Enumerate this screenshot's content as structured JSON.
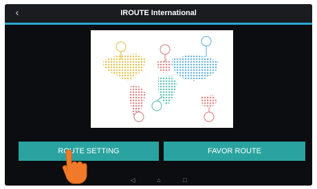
{
  "header": {
    "title": "IROUTE International",
    "back_icon": "chevron-left-icon"
  },
  "map": {
    "icon": "world-map-icon",
    "region_colors": [
      "#e3c65a",
      "#d98c8c",
      "#6fb7dc",
      "#67c3b8",
      "#e08a86"
    ]
  },
  "buttons": {
    "route_setting": "ROUTE SETTING",
    "favor_route": "FAVOR ROUTE"
  },
  "navbar": {
    "back_icon": "nav-back-icon",
    "home_icon": "nav-home-icon",
    "recents_icon": "nav-recents-icon"
  },
  "pointer": {
    "icon": "hand-pointer-icon"
  },
  "colors": {
    "accent": "#2aa8d6",
    "button": "#2aa3a0",
    "background": "#0c0d10"
  }
}
